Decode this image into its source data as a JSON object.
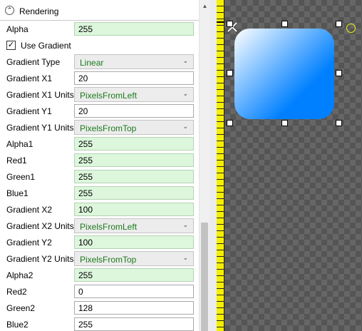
{
  "panel": {
    "section_title": "Rendering",
    "use_gradient_label": "Use Gradient",
    "use_gradient_checked": true,
    "rows": [
      {
        "label": "Alpha",
        "value": "255",
        "kind": "green"
      },
      {
        "label": "Gradient Type",
        "value": "Linear",
        "kind": "select"
      },
      {
        "label": "Gradient X1",
        "value": "20",
        "kind": "white"
      },
      {
        "label": "Gradient X1 Units",
        "value": "PixelsFromLeft",
        "kind": "select"
      },
      {
        "label": "Gradient Y1",
        "value": "20",
        "kind": "white"
      },
      {
        "label": "Gradient Y1 Units",
        "value": "PixelsFromTop",
        "kind": "select"
      },
      {
        "label": "Alpha1",
        "value": "255",
        "kind": "green"
      },
      {
        "label": "Red1",
        "value": "255",
        "kind": "green"
      },
      {
        "label": "Green1",
        "value": "255",
        "kind": "green"
      },
      {
        "label": "Blue1",
        "value": "255",
        "kind": "green"
      },
      {
        "label": "Gradient X2",
        "value": "100",
        "kind": "green"
      },
      {
        "label": "Gradient X2 Units",
        "value": "PixelsFromLeft",
        "kind": "select"
      },
      {
        "label": "Gradient Y2",
        "value": "100",
        "kind": "green"
      },
      {
        "label": "Gradient Y2 Units",
        "value": "PixelsFromTop",
        "kind": "select"
      },
      {
        "label": "Alpha2",
        "value": "255",
        "kind": "green"
      },
      {
        "label": "Red2",
        "value": "0",
        "kind": "white"
      },
      {
        "label": "Green2",
        "value": "128",
        "kind": "white"
      },
      {
        "label": "Blue2",
        "value": "255",
        "kind": "white"
      }
    ]
  },
  "canvas": {
    "gradient_start_color": "#ffffff",
    "gradient_end_color": "#0080ff",
    "ruler_color": "#f5ef00",
    "rotate_handle_color": "#f2f20a"
  },
  "icons": {
    "collapse": "chevron-up-icon",
    "dropdown": "chevron-down-icon",
    "check": "checkmark-icon"
  }
}
